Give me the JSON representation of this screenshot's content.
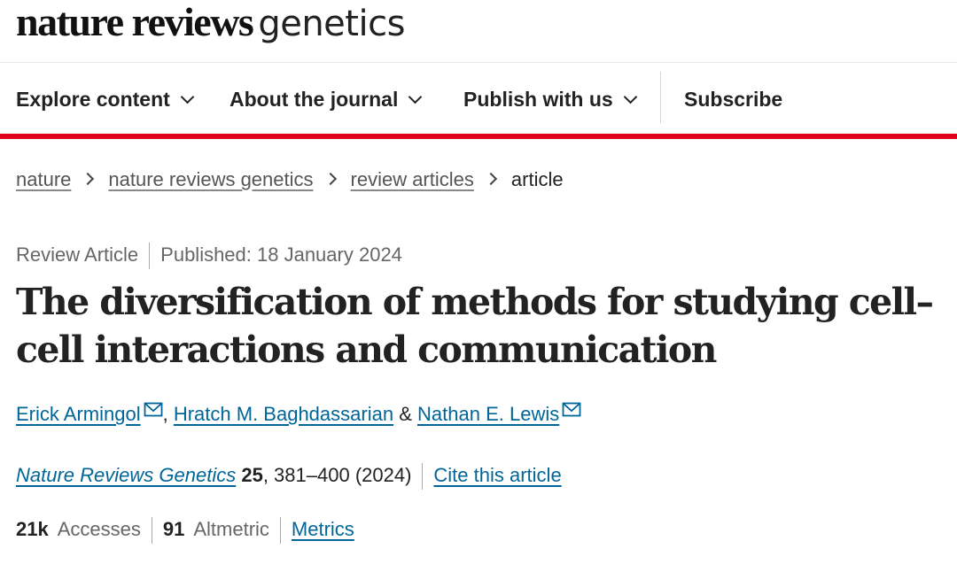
{
  "logo": {
    "bold": "nature reviews",
    "light": "genetics"
  },
  "nav": {
    "explore": "Explore content",
    "about": "About the journal",
    "publish": "Publish with us",
    "subscribe": "Subscribe"
  },
  "breadcrumb": {
    "items": [
      "nature",
      "nature reviews genetics",
      "review articles"
    ],
    "current": "article"
  },
  "article": {
    "type": "Review Article",
    "published": "Published: 18 January 2024",
    "title": "The diversification of methods for studying cell–cell interactions and communication",
    "authors": {
      "first": "Erick Armingol",
      "comma": ",",
      "second": "Hratch M. Baghdassarian",
      "amp": "&",
      "third": "Nathan E. Lewis"
    },
    "citation": {
      "journal": "Nature Reviews Genetics",
      "volume": "25",
      "pages_year": ", 381–400 (2024)",
      "cite": "Cite this article"
    },
    "metrics": {
      "accesses_value": "21k",
      "accesses_label": "Accesses",
      "altmetric_value": "91",
      "altmetric_label": "Altmetric",
      "metrics_link": "Metrics"
    }
  },
  "colors": {
    "accent_red": "#e0001b",
    "link": "#006699"
  },
  "icons": {
    "nav_chevron": "chevron-down-icon",
    "crumb_sep": "chevron-right-icon",
    "mail": "envelope-icon"
  }
}
